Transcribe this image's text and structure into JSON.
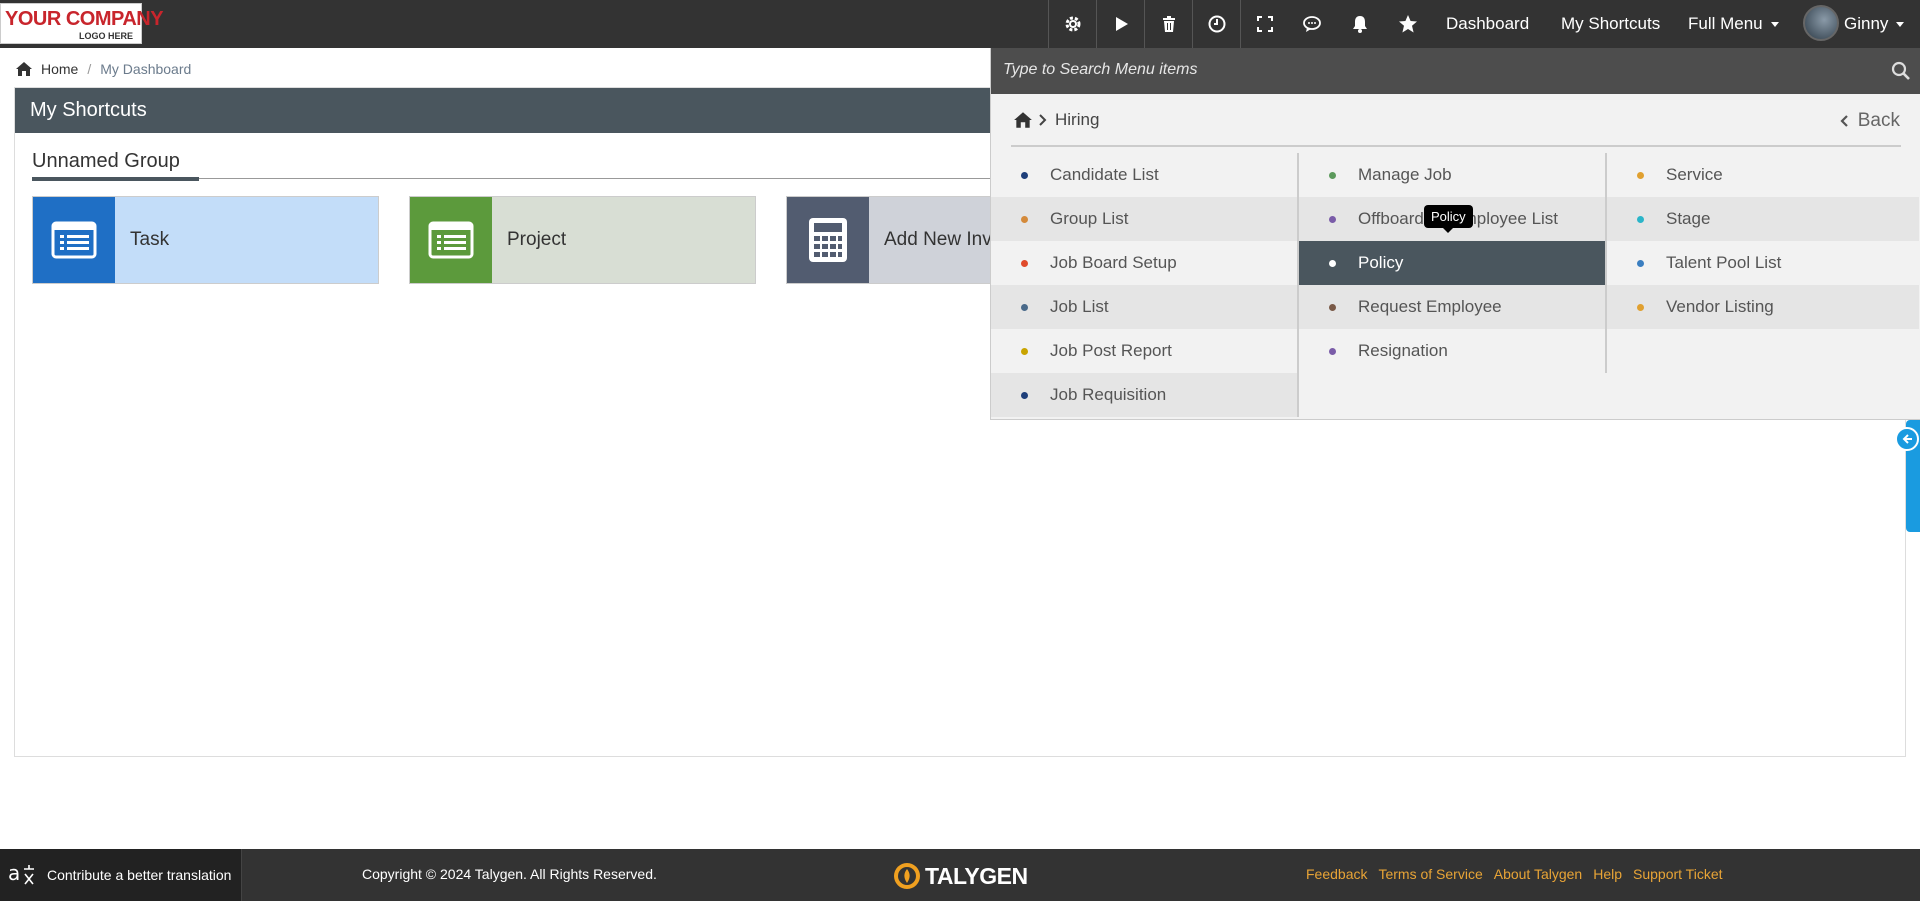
{
  "topbar": {
    "logo_line1": "YOUR COMPANY",
    "logo_line2": "LOGO HERE",
    "icons": [
      "gear-icon",
      "play-icon",
      "trash-icon",
      "clock-icon",
      "expand-icon",
      "chat-icon",
      "bell-icon",
      "star-icon"
    ],
    "nav": {
      "dashboard": "Dashboard",
      "shortcuts": "My Shortcuts",
      "full_menu": "Full Menu"
    },
    "user_name": "Ginny"
  },
  "breadcrumb": {
    "home": "Home",
    "current": "My Dashboard"
  },
  "shortcuts": {
    "title": "My Shortcuts",
    "group_title": "Unnamed Group",
    "tiles": [
      {
        "label": "Task",
        "icon": "list-icon",
        "icon_bg": "#1f6fc5",
        "bg": "#c3ddf9"
      },
      {
        "label": "Project",
        "icon": "list-icon",
        "icon_bg": "#5c9a3c",
        "bg": "#d8ded4"
      },
      {
        "label": "Add New Invoice",
        "icon": "calculator-icon",
        "icon_bg": "#525c70",
        "bg": "#cfd2d9"
      }
    ]
  },
  "menu": {
    "search_placeholder": "Type to Search Menu items",
    "crumb": "Hiring",
    "back": "Back",
    "columns": [
      [
        {
          "label": "Candidate List",
          "dot": "#1e3f7a"
        },
        {
          "label": "Group List",
          "dot": "#d48a3b"
        },
        {
          "label": "Job Board Setup",
          "dot": "#e04a2b"
        },
        {
          "label": "Job List",
          "dot": "#4a6a8a"
        },
        {
          "label": "Job Post Report",
          "dot": "#c9a400"
        },
        {
          "label": "Job Requisition",
          "dot": "#1e3f7a"
        }
      ],
      [
        {
          "label": "Manage Job",
          "dot": "#5c9a5c"
        },
        {
          "label": "Offboarding Employee List",
          "dot": "#7a5ca8"
        },
        {
          "label": "Policy",
          "dot": "#ffffff",
          "active": true
        },
        {
          "label": "Request Employee",
          "dot": "#7a5a48"
        },
        {
          "label": "Resignation",
          "dot": "#7a5ca8"
        }
      ],
      [
        {
          "label": "Service",
          "dot": "#e0a030"
        },
        {
          "label": "Stage",
          "dot": "#2bb5c9"
        },
        {
          "label": "Talent Pool List",
          "dot": "#3a7ec0"
        },
        {
          "label": "Vendor Listing",
          "dot": "#e0a030"
        }
      ]
    ],
    "tooltip": "Policy"
  },
  "footer": {
    "translate": "Contribute a better translation",
    "copyright": "Copyright © 2024 Talygen. All Rights Reserved.",
    "brand": "TALYGEN",
    "links": [
      "Feedback",
      "Terms of Service",
      "About Talygen",
      "Help",
      "Support Ticket"
    ]
  },
  "colors": {
    "topbar": "#333333",
    "panel_header": "#4a565e",
    "accent": "#1a9be0",
    "link": "#e8a436"
  }
}
